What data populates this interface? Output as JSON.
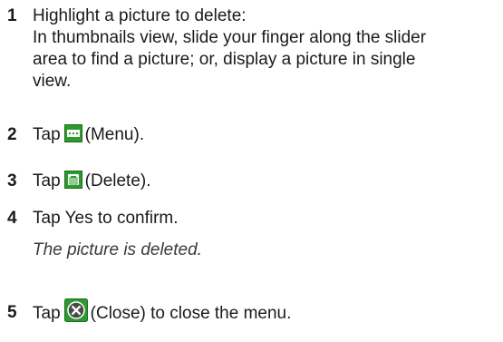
{
  "steps": [
    {
      "number": "1",
      "lines": [
        "Highlight a picture to delete:",
        "In thumbnails view, slide your finger along the slider",
        "area to find a picture; or, display a picture in single",
        "view."
      ]
    },
    {
      "number": "2",
      "before": "Tap",
      "icon": "menu-icon",
      "after": "(Menu)."
    },
    {
      "number": "3",
      "before": "Tap",
      "icon": "delete-icon",
      "after": "(Delete)."
    },
    {
      "number": "4",
      "text": "Tap Yes to confirm.",
      "note": "The picture is deleted."
    },
    {
      "number": "5",
      "before": "Tap",
      "icon": "close-icon",
      "after": "(Close) to close the menu."
    }
  ],
  "colors": {
    "icon_green": "#2e9a2e",
    "text": "#1a1a1a"
  }
}
